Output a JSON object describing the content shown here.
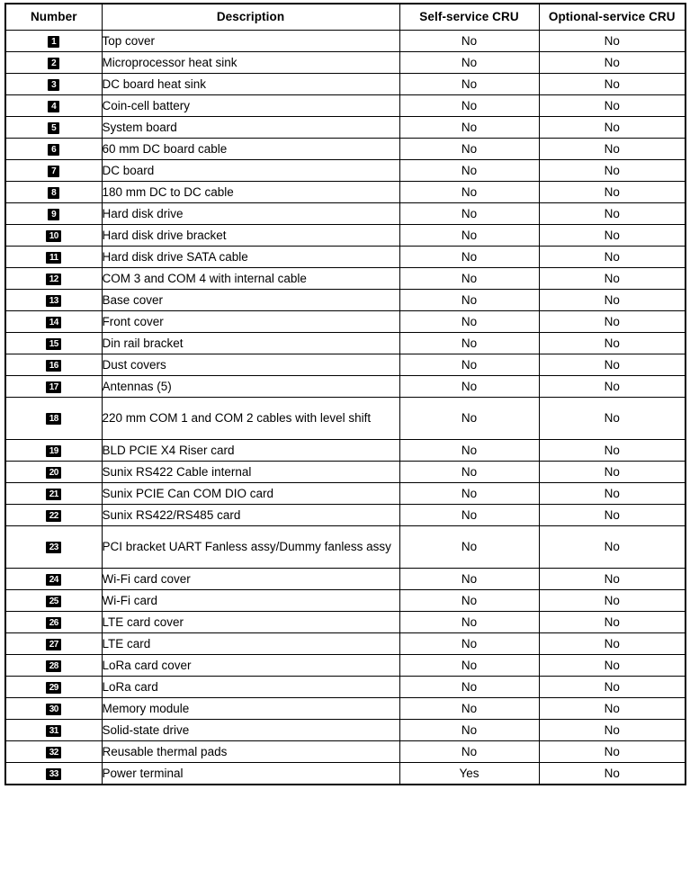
{
  "table": {
    "columns": [
      {
        "key": "number",
        "label": "Number"
      },
      {
        "key": "description",
        "label": "Description"
      },
      {
        "key": "self",
        "label": "Self-service CRU"
      },
      {
        "key": "optional",
        "label": "Optional-service CRU"
      }
    ],
    "rows": [
      {
        "number": "1",
        "description": "Top cover",
        "self": "No",
        "optional": "No"
      },
      {
        "number": "2",
        "description": "Microprocessor heat sink",
        "self": "No",
        "optional": "No"
      },
      {
        "number": "3",
        "description": "DC board heat sink",
        "self": "No",
        "optional": "No"
      },
      {
        "number": "4",
        "description": "Coin-cell battery",
        "self": "No",
        "optional": "No"
      },
      {
        "number": "5",
        "description": "System board",
        "self": "No",
        "optional": "No"
      },
      {
        "number": "6",
        "description": "60 mm DC board cable",
        "self": "No",
        "optional": "No"
      },
      {
        "number": "7",
        "description": "DC board",
        "self": "No",
        "optional": "No"
      },
      {
        "number": "8",
        "description": "180 mm DC to DC cable",
        "self": "No",
        "optional": "No"
      },
      {
        "number": "9",
        "description": "Hard disk drive",
        "self": "No",
        "optional": "No"
      },
      {
        "number": "10",
        "description": "Hard disk drive bracket",
        "self": "No",
        "optional": "No"
      },
      {
        "number": "11",
        "description": "Hard disk drive SATA cable",
        "self": "No",
        "optional": "No"
      },
      {
        "number": "12",
        "description": "COM 3 and COM 4 with internal cable",
        "self": "No",
        "optional": "No"
      },
      {
        "number": "13",
        "description": "Base cover",
        "self": "No",
        "optional": "No"
      },
      {
        "number": "14",
        "description": "Front cover",
        "self": "No",
        "optional": "No"
      },
      {
        "number": "15",
        "description": "Din rail bracket",
        "self": "No",
        "optional": "No"
      },
      {
        "number": "16",
        "description": "Dust covers",
        "self": "No",
        "optional": "No"
      },
      {
        "number": "17",
        "description": "Antennas (5)",
        "self": "No",
        "optional": "No"
      },
      {
        "number": "18",
        "description": "220 mm COM 1 and COM 2 cables with level shift",
        "self": "No",
        "optional": "No",
        "tall": true
      },
      {
        "number": "19",
        "description": "BLD PCIE X4 Riser card",
        "self": "No",
        "optional": "No"
      },
      {
        "number": "20",
        "description": "Sunix RS422 Cable internal",
        "self": "No",
        "optional": "No"
      },
      {
        "number": "21",
        "description": "Sunix PCIE Can COM DIO card",
        "self": "No",
        "optional": "No"
      },
      {
        "number": "22",
        "description": "Sunix RS422/RS485 card",
        "self": "No",
        "optional": "No"
      },
      {
        "number": "23",
        "description": "PCI bracket UART Fanless assy/Dummy fanless assy",
        "self": "No",
        "optional": "No",
        "tall": true
      },
      {
        "number": "24",
        "description": "Wi-Fi card cover",
        "self": "No",
        "optional": "No"
      },
      {
        "number": "25",
        "description": "Wi-Fi card",
        "self": "No",
        "optional": "No"
      },
      {
        "number": "26",
        "description": "LTE card cover",
        "self": "No",
        "optional": "No"
      },
      {
        "number": "27",
        "description": "LTE card",
        "self": "No",
        "optional": "No"
      },
      {
        "number": "28",
        "description": "LoRa card cover",
        "self": "No",
        "optional": "No"
      },
      {
        "number": "29",
        "description": "LoRa card",
        "self": "No",
        "optional": "No"
      },
      {
        "number": "30",
        "description": "Memory module",
        "self": "No",
        "optional": "No"
      },
      {
        "number": "31",
        "description": "Solid-state drive",
        "self": "No",
        "optional": "No"
      },
      {
        "number": "32",
        "description": "Reusable thermal pads",
        "self": "No",
        "optional": "No"
      },
      {
        "number": "33",
        "description": "Power terminal",
        "self": "Yes",
        "optional": "No"
      }
    ]
  },
  "colors": {
    "border": "#000000",
    "badge_background": "#000000",
    "badge_text": "#ffffff",
    "text": "#000000",
    "page_background": "#ffffff"
  }
}
